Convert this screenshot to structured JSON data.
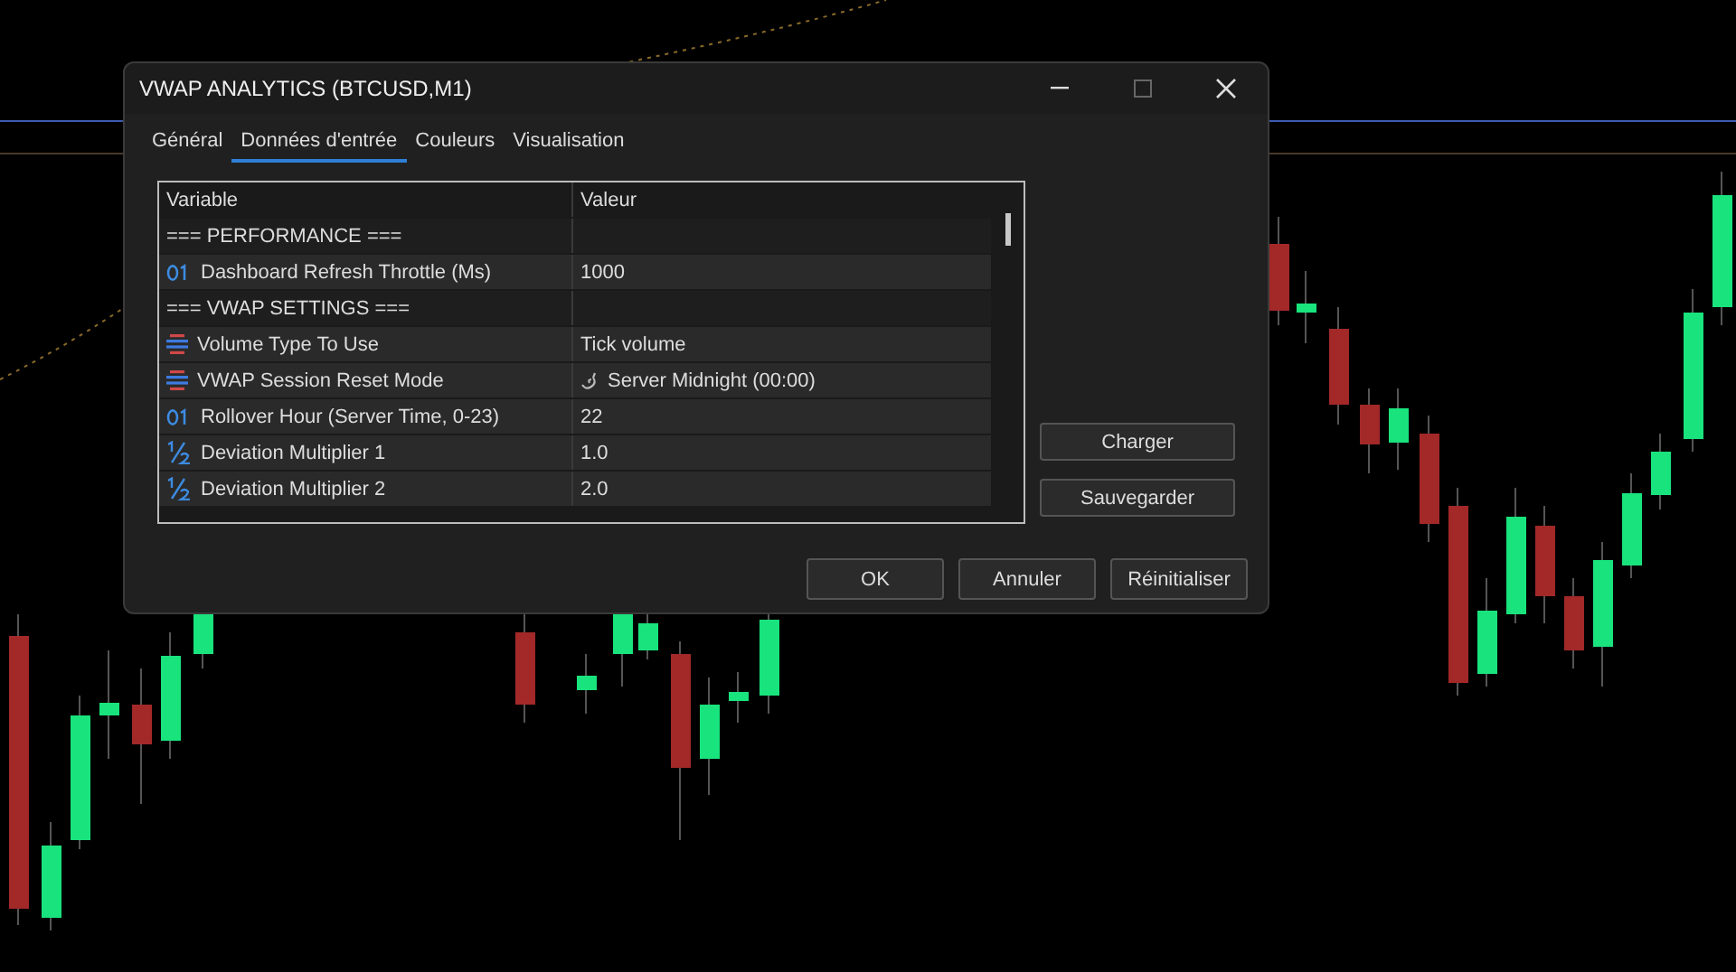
{
  "window": {
    "title": "VWAP ANALYTICS (BTCUSD,M1)"
  },
  "tabs": [
    {
      "label": "Général",
      "selected": false
    },
    {
      "label": "Données d'entrée",
      "selected": true
    },
    {
      "label": "Couleurs",
      "selected": false
    },
    {
      "label": "Visualisation",
      "selected": false
    }
  ],
  "table": {
    "columns": [
      "Variable",
      "Valeur"
    ],
    "rows": [
      {
        "kind": "section",
        "variable": "=== PERFORMANCE ==="
      },
      {
        "kind": "int",
        "variable": "Dashboard Refresh Throttle (Ms)",
        "value": "1000"
      },
      {
        "kind": "section",
        "variable": "=== VWAP SETTINGS ==="
      },
      {
        "kind": "enum",
        "variable": "Volume Type To Use",
        "value": "Tick volume",
        "value_icon": false
      },
      {
        "kind": "enum",
        "variable": "VWAP Session Reset Mode",
        "value": "Server Midnight (00:00)",
        "value_icon": true
      },
      {
        "kind": "int",
        "variable": "Rollover Hour (Server Time, 0-23)",
        "value": "22"
      },
      {
        "kind": "double",
        "variable": "Deviation Multiplier 1",
        "value": "1.0"
      },
      {
        "kind": "double",
        "variable": "Deviation Multiplier 2",
        "value": "2.0"
      }
    ]
  },
  "side_buttons": [
    "Charger",
    "Sauvegarder"
  ],
  "buttons": [
    "OK",
    "Annuler",
    "Réinitialiser"
  ]
}
